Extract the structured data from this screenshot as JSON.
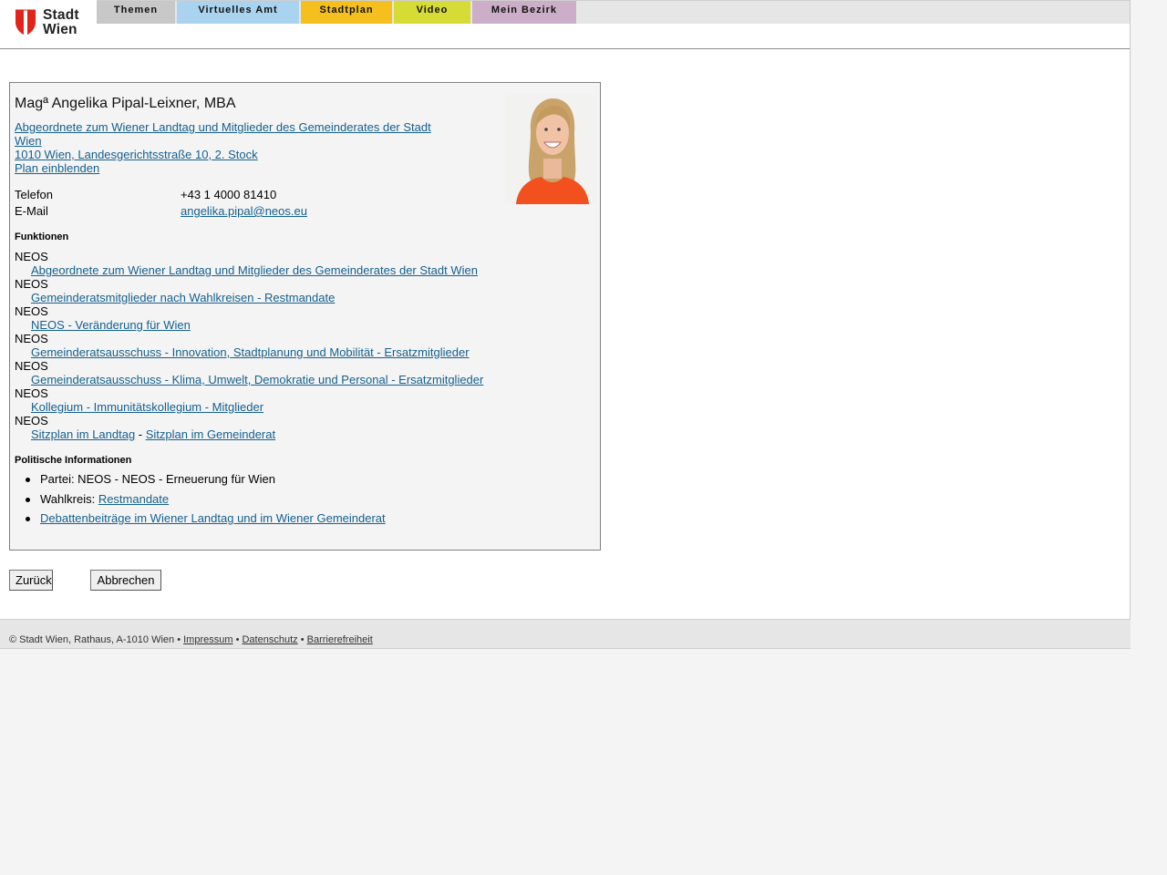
{
  "header": {
    "logo_line1": "Stadt",
    "logo_line2": "Wien",
    "nav": [
      {
        "label": "Themen",
        "color": "#c8c8c8"
      },
      {
        "label": "Virtuelles Amt",
        "color": "#a9d3ef"
      },
      {
        "label": "Stadtplan",
        "color": "#f5bf1d"
      },
      {
        "label": "Video",
        "color": "#d7db35"
      },
      {
        "label": "Mein Bezirk",
        "color": "#ccaec8"
      }
    ]
  },
  "person": {
    "name": "Magª Angelika Pipal-Leixner, MBA",
    "role_link_line1": "Abgeordnete zum Wiener Landtag und Mitglieder des Gemeinderates der Stadt",
    "role_link_line2": "Wien ",
    "address_link": "1010 Wien, Landesgerichtsstraße 10, 2. Stock",
    "plan_link": "Plan einblenden",
    "phone_label": "Telefon",
    "phone_value": "+43 1 4000 81410",
    "email_label": "E-Mail",
    "email_value": "angelika.pipal@neos.eu"
  },
  "functions": {
    "title": "Funktionen",
    "items": [
      {
        "org": "NEOS",
        "link": "Abgeordnete zum Wiener Landtag und Mitglieder des Gemeinderates der Stadt Wien"
      },
      {
        "org": "NEOS",
        "link": "Gemeinderatsmitglieder nach Wahlkreisen - Restmandate"
      },
      {
        "org": "NEOS",
        "link": "NEOS - Veränderung für Wien"
      },
      {
        "org": "NEOS",
        "link": "Gemeinderatsausschuss - Innovation, Stadtplanung und Mobilität - Ersatzmitglieder"
      },
      {
        "org": "NEOS",
        "link": "Gemeinderatsausschuss - Klima, Umwelt, Demokratie und Personal - Ersatzmitglieder"
      },
      {
        "org": "NEOS",
        "link": "Kollegium - Immunitätskollegium - Mitglieder"
      }
    ],
    "last_org": "NEOS",
    "seat_link_1": "Sitzplan im Landtag",
    "seat_separator": " - ",
    "seat_link_2": "Sitzplan im Gemeinderat"
  },
  "political": {
    "title": "Politische Informationen",
    "party_text": "Partei: NEOS - NEOS - Erneuerung für Wien",
    "district_label": "Wahlkreis: ",
    "district_link": "Restmandate",
    "debate_link": "Debattenbeiträge im Wiener Landtag und im Wiener Gemeinderat"
  },
  "buttons": {
    "back": "Zurück",
    "cancel": "Abbrechen"
  },
  "footer": {
    "text": "© Stadt Wien, Rathaus, A-1010 Wien • ",
    "impressum": "Impressum",
    "sep1": " • ",
    "datenschutz": "Datenschutz",
    "sep2": " • ",
    "barrierefreiheit": "Barrierefreiheit"
  }
}
